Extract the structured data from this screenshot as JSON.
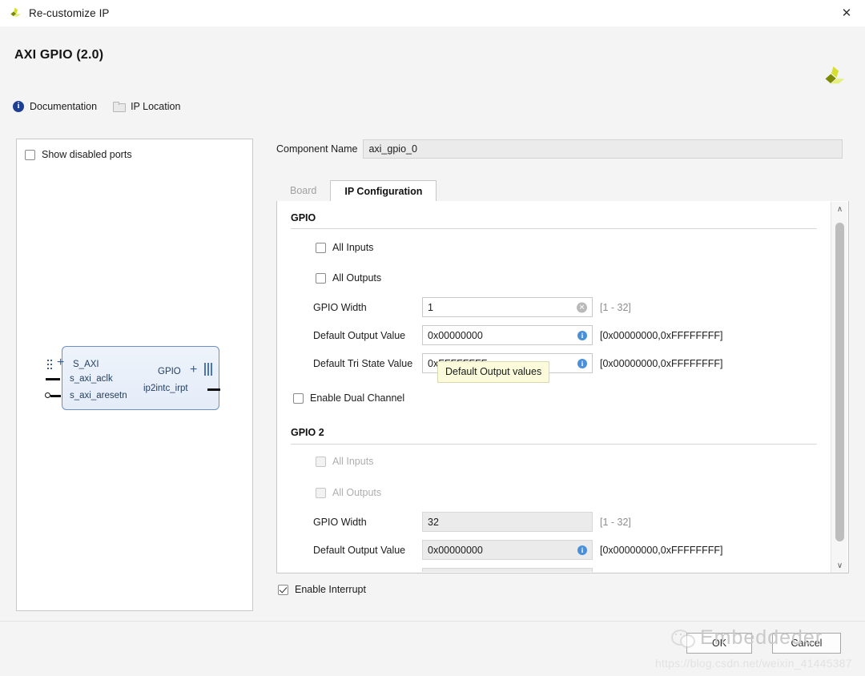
{
  "window": {
    "title": "Re-customize IP",
    "close_label": "✕",
    "app_icon": "xilinx-logo-icon"
  },
  "header": {
    "title": "AXI GPIO (2.0)",
    "logo_icon": "xilinx-logo-icon",
    "links": [
      {
        "label": "Documentation",
        "icon": "info-icon"
      },
      {
        "label": "IP Location",
        "icon": "folder-icon"
      }
    ]
  },
  "ports_panel": {
    "show_disabled_ports": {
      "label": "Show disabled ports",
      "checked": false
    },
    "diagram": {
      "left_ports": [
        {
          "label": "S_AXI",
          "connector": "bus-plus"
        },
        {
          "label": "s_axi_aclk",
          "connector": "pin"
        },
        {
          "label": "s_axi_aresetn",
          "connector": "pin-inverted"
        }
      ],
      "right_ports": [
        {
          "label": "GPIO",
          "connector": "bus-plus"
        },
        {
          "label": "ip2intc_irpt",
          "connector": "pin"
        }
      ]
    }
  },
  "component_name": {
    "label": "Component Name",
    "value": "axi_gpio_0"
  },
  "tabs": [
    {
      "label": "Board",
      "active": false,
      "disabled": true
    },
    {
      "label": "IP Configuration",
      "active": true,
      "disabled": false
    }
  ],
  "config": {
    "sections": [
      {
        "title": "GPIO",
        "checkboxes": [
          {
            "label": "All Inputs",
            "checked": false,
            "disabled": false
          },
          {
            "label": "All Outputs",
            "checked": false,
            "disabled": false
          }
        ],
        "fields": [
          {
            "label": "GPIO Width",
            "value": "1",
            "range": "[1 - 32]",
            "icon": "clear-icon",
            "disabled": false
          },
          {
            "label": "Default Output Value",
            "value": "0x00000000",
            "range": "[0x00000000,0xFFFFFFFF]",
            "icon": "info-icon",
            "disabled": false
          },
          {
            "label": "Default Tri State Value",
            "value": "0xFFFFFFFF",
            "range": "[0x00000000,0xFFFFFFFF]",
            "icon": "info-icon",
            "disabled": false
          }
        ]
      },
      {
        "title": "GPIO 2",
        "checkboxes": [
          {
            "label": "All Inputs",
            "checked": false,
            "disabled": true
          },
          {
            "label": "All Outputs",
            "checked": false,
            "disabled": true
          }
        ],
        "fields": [
          {
            "label": "GPIO Width",
            "value": "32",
            "range": "[1 - 32]",
            "icon": "none",
            "disabled": true
          },
          {
            "label": "Default Output Value",
            "value": "0x00000000",
            "range": "[0x00000000,0xFFFFFFFF]",
            "icon": "info-icon",
            "disabled": true
          }
        ]
      }
    ],
    "enable_dual_channel": {
      "label": "Enable Dual Channel",
      "checked": false
    },
    "enable_interrupt": {
      "label": "Enable Interrupt",
      "checked": true
    },
    "tooltip": {
      "text": "Default Output values"
    }
  },
  "scrollbar": {
    "up_arrow": "∧",
    "down_arrow": "∨"
  },
  "footer": {
    "ok_label": "OK",
    "cancel_label": "Cancel"
  },
  "watermark": {
    "brand_text": "Embeddeder",
    "url": "https://blog.csdn.net/weixin_41445387"
  },
  "colors": {
    "accent_blue": "#4a90d9",
    "tab_active_bg": "#ffffff",
    "panel_bg": "#f4f4f4",
    "tooltip_bg": "#fbfbdc",
    "logo_green": "#c8d400",
    "block_border": "#6f8fc0"
  }
}
